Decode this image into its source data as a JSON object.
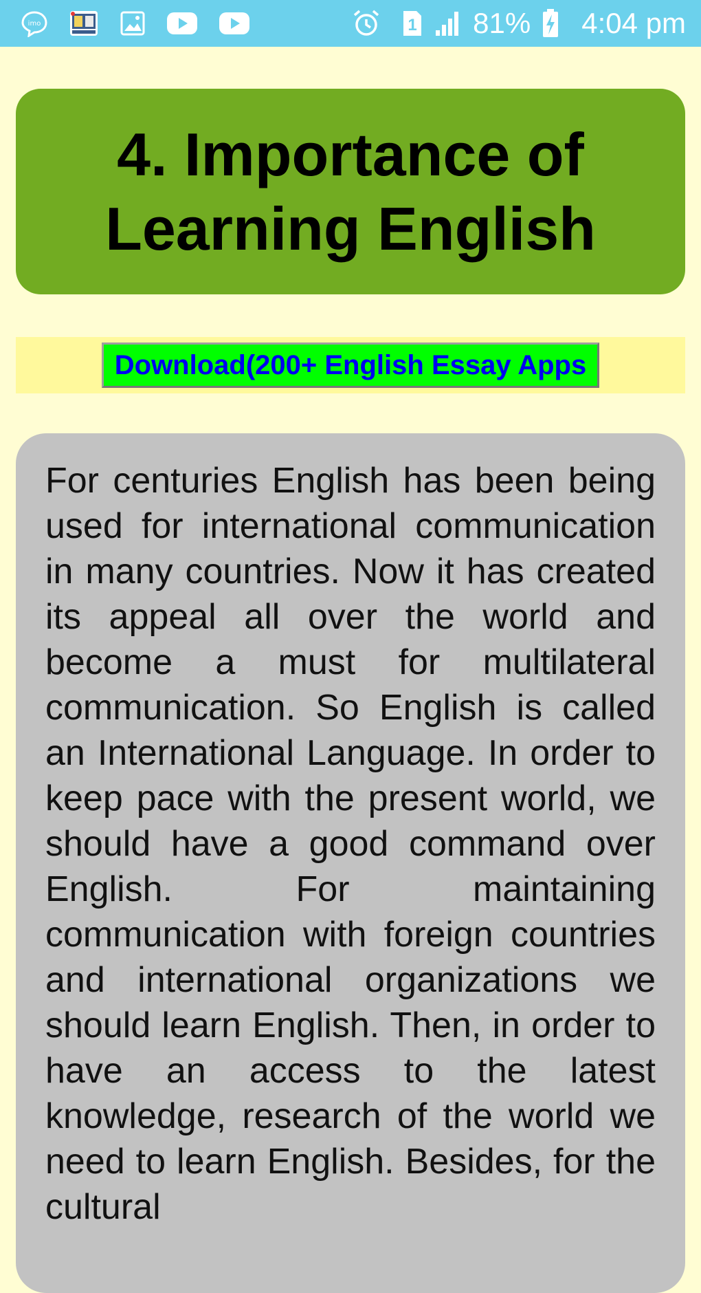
{
  "status_bar": {
    "left_icons": [
      "imo-icon",
      "dictionary-app-icon",
      "gallery-icon",
      "youtube-icon",
      "youtube-icon"
    ],
    "right_icons": [
      "alarm-icon",
      "sim-1-icon",
      "signal-icon",
      "battery-charging-icon"
    ],
    "battery": "81%",
    "time": "4:04 pm"
  },
  "title": {
    "text": "4. Importance of Learning English"
  },
  "download": {
    "label": "Download(200+ English Essay Apps"
  },
  "essay": {
    "text": "For centuries English has been being used for international communication in many countries. Now it has created its appeal all over the world and become a must for multilateral communication. So English is called an International Language. In order to keep pace with the present world, we should have a good command over English. For maintaining communication with foreign countries and international organizations we should learn English. Then, in order to have an access to the latest knowledge, research of the world we need to learn English. Besides, for the cultural"
  },
  "colors": {
    "status_bar": "#6CD1EC",
    "page_background": "#FFFDD3",
    "title_card": "#72AC22",
    "download_band": "#FFF99C",
    "download_button": "#00FF00",
    "download_text": "#0000F0",
    "essay_card": "#C2C2C2"
  }
}
